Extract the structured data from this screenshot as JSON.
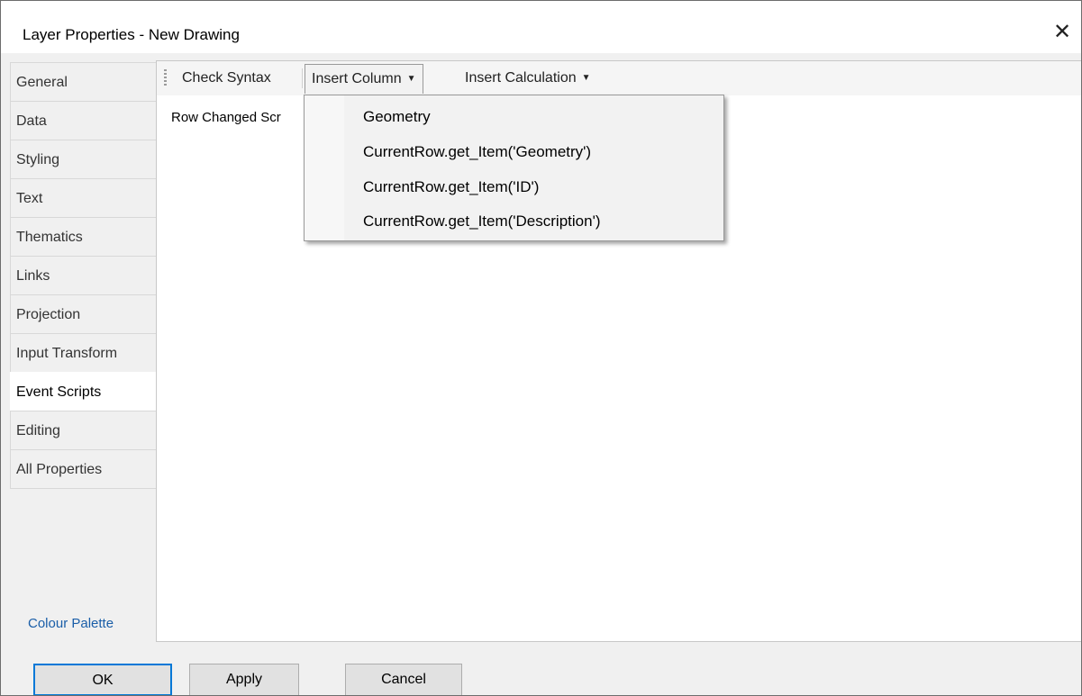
{
  "window": {
    "title": "Layer Properties - New Drawing",
    "close_glyph": "✕"
  },
  "tabs": [
    {
      "label": "General",
      "active": false
    },
    {
      "label": "Data",
      "active": false
    },
    {
      "label": "Styling",
      "active": false
    },
    {
      "label": "Text",
      "active": false
    },
    {
      "label": "Thematics",
      "active": false
    },
    {
      "label": "Links",
      "active": false
    },
    {
      "label": "Projection",
      "active": false
    },
    {
      "label": "Input Transform",
      "active": false
    },
    {
      "label": "Event Scripts",
      "active": true
    },
    {
      "label": "Editing",
      "active": false
    },
    {
      "label": "All Properties",
      "active": false
    }
  ],
  "colour_palette_link": "Colour Palette",
  "toolbar": {
    "check_syntax": "Check Syntax",
    "insert_column": "Insert Column",
    "insert_calculation": "Insert Calculation",
    "caret": "▼"
  },
  "script_label": "Row Changed Scr",
  "insert_column_menu": [
    "Geometry",
    "CurrentRow.get_Item('Geometry')",
    "CurrentRow.get_Item('ID')",
    "CurrentRow.get_Item('Description')"
  ],
  "buttons": {
    "ok": "OK",
    "apply": "Apply",
    "cancel": "Cancel"
  },
  "colors": {
    "accent": "#0078d7",
    "link": "#1a5ea8"
  }
}
